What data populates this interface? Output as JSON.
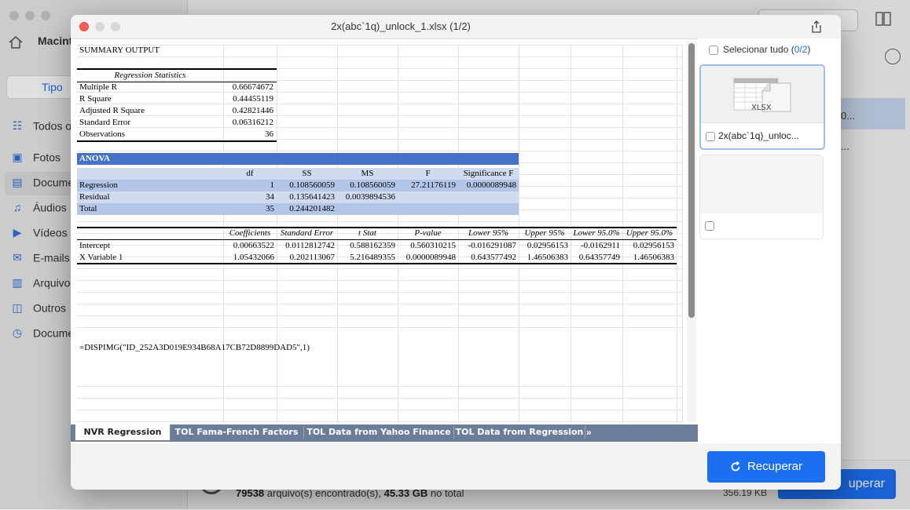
{
  "background": {
    "drive_label": "Macint",
    "filter_tab": "Tipo",
    "sidebar_items": [
      {
        "label": "Todos o",
        "icon": "grid-icon"
      },
      {
        "label": "Fotos",
        "icon": "photo-icon"
      },
      {
        "label": "Docume",
        "icon": "document-icon"
      },
      {
        "label": "Áudios",
        "icon": "music-icon"
      },
      {
        "label": "Vídeos",
        "icon": "video-icon"
      },
      {
        "label": "E-mails",
        "icon": "mail-icon"
      },
      {
        "label": "Arquivo",
        "icon": "archive-icon"
      },
      {
        "label": "Outros",
        "icon": "other-icon"
      },
      {
        "label": "Docume",
        "icon": "document-clock-icon"
      }
    ],
    "row_selected_text": "0...",
    "row_text": "...",
    "found_count": "79538",
    "found_text": " arquivo(s) encontrado(s), ",
    "found_size": "45.33 GB",
    "found_suffix": " no total",
    "selected_size": "356.19 KB",
    "recover_label": "uperar"
  },
  "modal": {
    "title": "2x(abc`1q)_unlock_1.xlsx (1/2)",
    "select_all_label": "Selecionar tudo (",
    "select_all_count": "0/2",
    "select_all_close": ")",
    "thumb_ext": "XLSX",
    "thumb_label": "2x(abc`1q)_unloc...",
    "recover_label": "Recuperar"
  },
  "sheet": {
    "summary_title": "SUMMARY OUTPUT",
    "reg_stats_title": "Regression Statistics",
    "reg_stats": [
      {
        "label": "Multiple R",
        "value": "0.66674672"
      },
      {
        "label": "R Square",
        "value": "0.44455119"
      },
      {
        "label": "Adjusted R Square",
        "value": "0.42821446"
      },
      {
        "label": "Standard Error",
        "value": "0.06316212"
      },
      {
        "label": "Observations",
        "value": "36"
      }
    ],
    "anova_title": "ANOVA",
    "anova_headers": [
      "df",
      "SS",
      "MS",
      "F",
      "Significance F"
    ],
    "anova_rows": [
      {
        "label": "Regression",
        "cells": [
          "1",
          "0.108560059",
          "0.108560059",
          "27.21176119",
          "0.0000089948"
        ]
      },
      {
        "label": "Residual",
        "cells": [
          "34",
          "0.135641423",
          "0.0039894536",
          "",
          ""
        ]
      },
      {
        "label": "Total",
        "cells": [
          "35",
          "0.244201482",
          "",
          "",
          ""
        ]
      }
    ],
    "coef_headers": [
      "Coefficients",
      "Standard Error",
      "t Stat",
      "P-value",
      "Lower 95%",
      "Upper 95%",
      "Lower 95.0%",
      "Upper 95.0%"
    ],
    "coef_rows": [
      {
        "label": "Intercept",
        "cells": [
          "0.00663522",
          "0.0112812742",
          "0.588162359",
          "0.560310215",
          "-0.016291087",
          "0.02956153",
          "-0.0162911",
          "0.02956153"
        ]
      },
      {
        "label": "X Variable 1",
        "cells": [
          "1.05432066",
          "0.202113067",
          "5.216489355",
          "0.0000089948",
          "0.643577492",
          "1.46506383",
          "0.64357749",
          "1.46506383"
        ]
      }
    ],
    "formula": "=DISPIMG(\"ID_252A3D019E934B68A17CB72D8899DAD5\",1)"
  },
  "tabs": [
    "NVR Regression",
    "TOL Fama-French Factors",
    "TOL Data from Yahoo Finance",
    "TOL Data from Regression"
  ],
  "tabs_more": "»",
  "colors": {
    "accent": "#1d6ff2",
    "anova_header": "#4472c4",
    "anova_row_light": "#d0dbef",
    "close_red": "#ff5f57"
  }
}
